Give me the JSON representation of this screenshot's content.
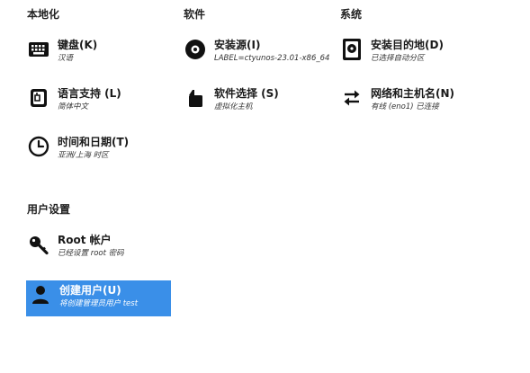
{
  "sections": {
    "localization": "本地化",
    "software": "软件",
    "system": "系统",
    "user_settings": "用户设置"
  },
  "spokes": {
    "keyboard": {
      "label": "键盘(K)",
      "status": "汉语",
      "icon": "keyboard-icon"
    },
    "language": {
      "label": "语言支持 (L)",
      "status": "简体中文",
      "icon": "language-icon"
    },
    "datetime": {
      "label": "时间和日期(T)",
      "status": "亚洲/上海 时区",
      "icon": "clock-icon"
    },
    "source": {
      "label": "安装源(I)",
      "status": "LABEL=ctyunos-23.01-x86_64:",
      "icon": "disc-icon"
    },
    "software_selection": {
      "label": "软件选择 (S)",
      "status": "虚拟化主机",
      "icon": "package-icon"
    },
    "destination": {
      "label": "安装目的地(D)",
      "status": "已选择自动分区",
      "icon": "harddisk-icon"
    },
    "network": {
      "label": "网络和主机名(N)",
      "status": "有线 (eno1) 已连接",
      "icon": "network-arrows-icon"
    },
    "root": {
      "label": "Root 帐户",
      "status": "已经设置 root 密码",
      "icon": "key-icon"
    },
    "user": {
      "label": "创建用户(U)",
      "status": "将创建管理员用户 test",
      "icon": "user-icon"
    }
  },
  "colors": {
    "selected_bg": "#3a8fe8",
    "text": "#1a1a1a"
  }
}
